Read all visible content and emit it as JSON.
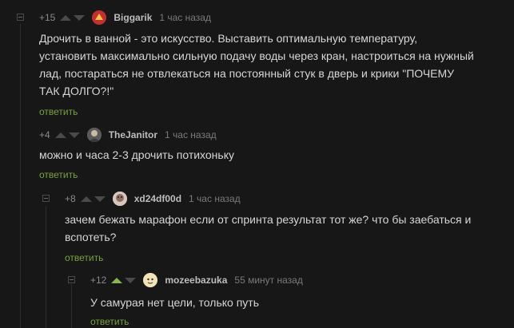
{
  "comments": [
    {
      "rating": "+15",
      "author": "Biggarik",
      "time": "1 час назад",
      "text": "Дрочить в ванной - это искусство. Выставить оптимальную температуру, установить максимально сильную подачу воды через кран, настроиться на нужный лад, постараться не отвлекаться на постоянный стук в дверь и крики \"ПОЧЕМУ ТАК ДОЛГО?!\"",
      "reply": "ответить",
      "upvoted": false,
      "avatar_color": "#c0302e"
    },
    {
      "rating": "+4",
      "author": "TheJanitor",
      "time": "1 час назад",
      "text": "можно и часа 2-3 дрочить потихоньку",
      "reply": "ответить",
      "upvoted": false,
      "avatar_color": "#6b6b6b"
    },
    {
      "rating": "+8",
      "author": "xd24df00d",
      "time": "1 час назад",
      "text": "зачем бежать марафон если от спринта результат тот же? что бы заебаться и вспотеть?",
      "reply": "ответить",
      "upvoted": false,
      "avatar_color": "#b59a8e"
    },
    {
      "rating": "+12",
      "author": "mozeebazuka",
      "time": "55 минут назад",
      "text": "У самурая нет цели, только путь",
      "reply": "ответить",
      "upvoted": true,
      "avatar_color": "#e8d6a8"
    }
  ],
  "colors": {
    "background": "#171717",
    "reply_link": "#76a33e",
    "upvote_active": "#8ab54a"
  }
}
